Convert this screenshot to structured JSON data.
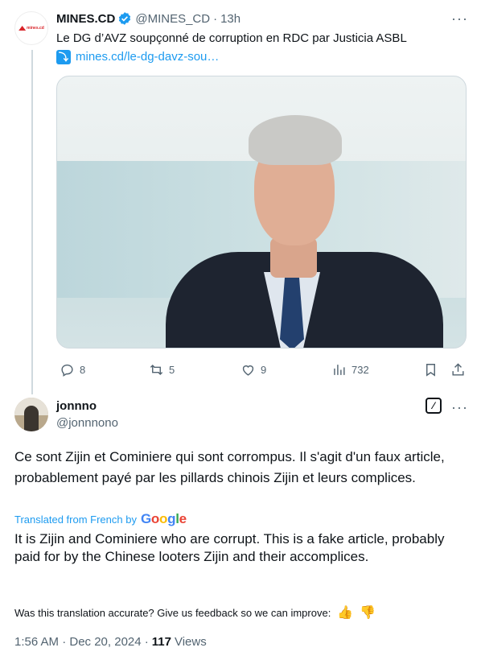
{
  "parent_tweet": {
    "author_name": "MINES.CD",
    "handle": "@MINES_CD",
    "separator": "·",
    "time": "13h",
    "text": "Le DG d’AVZ soupçonné de corruption en RDC par Justicia ASBL",
    "link_text": "mines.cd/le-dg-davz-sou…",
    "avatar_logo_text": "mines.cd",
    "more_label": "···",
    "actions": {
      "replies": "8",
      "reposts": "5",
      "likes": "9",
      "views": "732"
    }
  },
  "reply": {
    "author_name": "jonnno",
    "handle": "@jonnnono",
    "more_label": "···",
    "original_text": "Ce sont Zijin et Cominiere qui sont corrompus. Il s'agit d'un faux article, probablement payé par les pillards chinois Zijin et leurs complices.",
    "translated_from": "Translated from French by",
    "translation_provider": "Google",
    "translated_text": "It is Zijin and Cominiere who are corrupt. This is a fake article, probably paid for by the Chinese looters Zijin and their accomplices.",
    "feedback_prompt": "Was this translation accurate? Give us feedback so we can improve:",
    "timestamp": "1:56 AM · Dec 20, 2024 ·",
    "views_count": "117",
    "views_label": "Views"
  },
  "colors": {
    "accent": "#1d9bf0",
    "muted": "#536471",
    "text": "#0f1419",
    "thread_line": "#cfd9de"
  },
  "icons": [
    "verified-badge-icon",
    "link-arrow-icon",
    "reply-icon",
    "repost-icon",
    "like-icon",
    "analytics-icon",
    "bookmark-icon",
    "share-icon",
    "grok-icon",
    "more-icon",
    "thumbs-up-icon",
    "thumbs-down-icon"
  ]
}
